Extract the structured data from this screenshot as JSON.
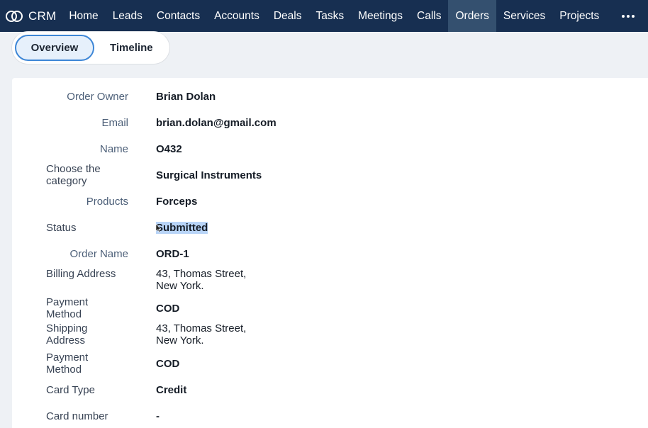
{
  "nav": {
    "brand": "CRM",
    "items": [
      {
        "label": "Home",
        "active": false
      },
      {
        "label": "Leads",
        "active": false
      },
      {
        "label": "Contacts",
        "active": false
      },
      {
        "label": "Accounts",
        "active": false
      },
      {
        "label": "Deals",
        "active": false
      },
      {
        "label": "Tasks",
        "active": false
      },
      {
        "label": "Meetings",
        "active": false
      },
      {
        "label": "Calls",
        "active": false
      },
      {
        "label": "Orders",
        "active": true
      },
      {
        "label": "Services",
        "active": false
      },
      {
        "label": "Projects",
        "active": false
      }
    ],
    "more_icon": "more-horizontal-icon"
  },
  "tabs": {
    "overview": "Overview",
    "timeline": "Timeline"
  },
  "fields": {
    "order_owner": {
      "label": "Order Owner",
      "value": "Brian Dolan"
    },
    "email": {
      "label": "Email",
      "value": "brian.dolan@gmail.com"
    },
    "name": {
      "label": "Name",
      "value": "O432"
    },
    "category": {
      "label": "Choose the category",
      "value": "Surgical Instruments"
    },
    "products": {
      "label": "Products",
      "value": "Forceps"
    },
    "status": {
      "label": "Status",
      "value": "Submitted"
    },
    "order_name": {
      "label": "Order Name",
      "value": "ORD-1"
    },
    "billing_address": {
      "label": "Billing Address",
      "value_line1": "43, Thomas Street,",
      "value_line2": "New York."
    },
    "payment_method_1": {
      "label_line1": "Payment",
      "label_line2": "Method",
      "value": "COD"
    },
    "shipping_address": {
      "label_line1": "Shipping",
      "label_line2": "Address",
      "value_line1": "43, Thomas Street,",
      "value_line2": "New York."
    },
    "payment_method_2": {
      "label_line1": "Payment",
      "label_line2": "Method",
      "value": "COD"
    },
    "card_type": {
      "label": "Card Type",
      "value": "Credit"
    },
    "card_number": {
      "label": "Card number",
      "value": "-"
    }
  },
  "colors": {
    "nav_bg": "#172f51",
    "nav_active": "#34506f",
    "tab_active_border": "#3d86d6",
    "selection": "#b8d4f7"
  }
}
